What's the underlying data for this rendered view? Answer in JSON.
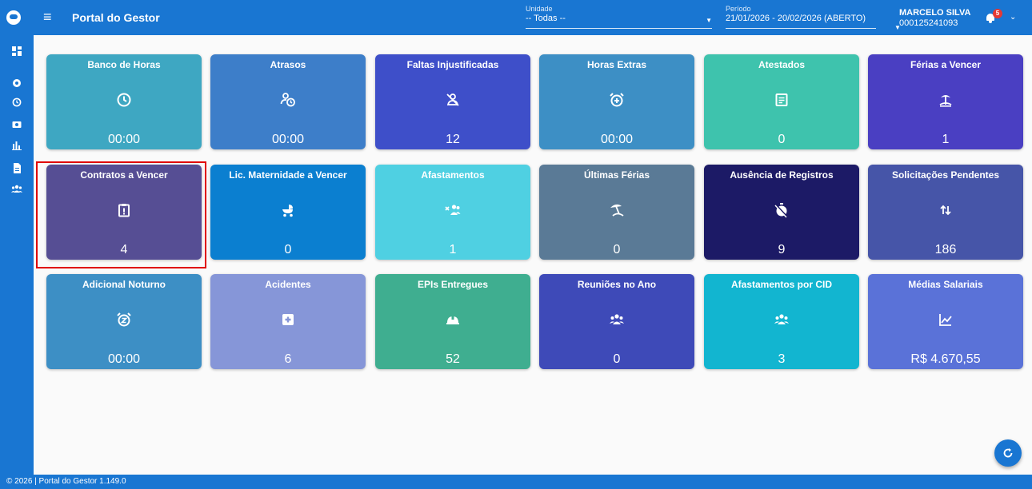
{
  "header": {
    "title": "Portal do Gestor",
    "unit_label": "Unidade",
    "unit_value": "-- Todas --",
    "period_label": "Período",
    "period_value": "21/01/2026 - 20/02/2026 (ABERTO)",
    "user_name": "MARCELO SILVA",
    "user_id": "000125241093",
    "notification_count": "5"
  },
  "sidebar": {
    "items": [
      {
        "icon": "dashboard-icon"
      },
      {
        "icon": "eye-icon"
      },
      {
        "icon": "clock-icon"
      },
      {
        "icon": "money-icon"
      },
      {
        "icon": "bar-chart-icon"
      },
      {
        "icon": "document-icon"
      },
      {
        "icon": "group-icon"
      }
    ]
  },
  "cards": [
    {
      "title": "Banco de Horas",
      "value": "00:00",
      "color": "#3ea7c2",
      "icon": "clock-icon"
    },
    {
      "title": "Atrasos",
      "value": "00:00",
      "color": "#3d7ec9",
      "icon": "late-clock-icon"
    },
    {
      "title": "Faltas Injustificadas",
      "value": "12",
      "color": "#3e4fc9",
      "icon": "person-off-icon"
    },
    {
      "title": "Horas Extras",
      "value": "00:00",
      "color": "#3d8fc5",
      "icon": "add-alarm-icon"
    },
    {
      "title": "Atestados",
      "value": "0",
      "color": "#3ec3ad",
      "icon": "document-icon"
    },
    {
      "title": "Férias a Vencer",
      "value": "1",
      "color": "#4a3fc2",
      "icon": "beach-icon"
    },
    {
      "title": "Contratos a Vencer",
      "value": "4",
      "color": "#564e94",
      "icon": "clipboard-alert-icon"
    },
    {
      "title": "Lic. Maternidade a Vencer",
      "value": "0",
      "color": "#0b7fd0",
      "icon": "stroller-icon"
    },
    {
      "title": "Afastamentos",
      "value": "1",
      "color": "#4fd0e2",
      "icon": "group-off-icon"
    },
    {
      "title": "Últimas Férias",
      "value": "0",
      "color": "#5a7a96",
      "icon": "umbrella-icon"
    },
    {
      "title": "Ausência de Registros",
      "value": "9",
      "color": "#1c1a66",
      "icon": "timer-off-icon"
    },
    {
      "title": "Solicitações Pendentes",
      "value": "186",
      "color": "#4655a8",
      "icon": "swap-vert-icon"
    },
    {
      "title": "Adicional Noturno",
      "value": "00:00",
      "color": "#3d8fc5",
      "icon": "snooze-alarm-icon"
    },
    {
      "title": "Acidentes",
      "value": "6",
      "color": "#8696d8",
      "icon": "medical-plus-icon"
    },
    {
      "title": "EPIs Entregues",
      "value": "52",
      "color": "#3fae90",
      "icon": "hard-hat-icon"
    },
    {
      "title": "Reuniões no Ano",
      "value": "0",
      "color": "#3e4ab8",
      "icon": "group-icon"
    },
    {
      "title": "Afastamentos por CID",
      "value": "3",
      "color": "#12b5d0",
      "icon": "group-icon"
    },
    {
      "title": "Médias Salariais",
      "value": "R$ 4.670,55",
      "color": "#5a72d8",
      "icon": "trend-chart-icon"
    }
  ],
  "footer": {
    "text": "© 2026 | Portal do Gestor 1.149.0"
  }
}
